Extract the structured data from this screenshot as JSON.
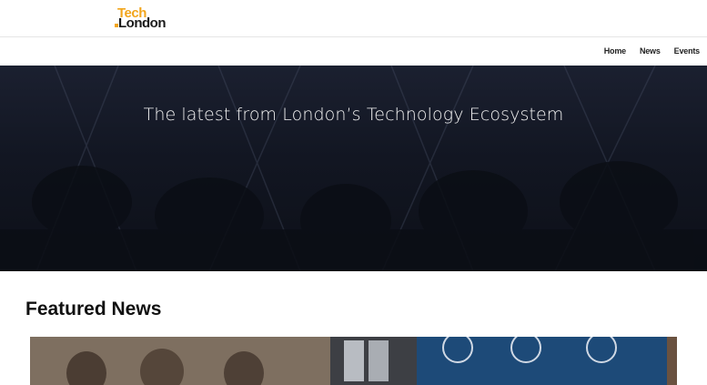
{
  "header": {
    "logo": {
      "line1": "Tech",
      "line2": "London",
      "brand_color": "#f2a51b"
    }
  },
  "nav": {
    "items": [
      {
        "label": "Home"
      },
      {
        "label": "News"
      },
      {
        "label": "Events"
      }
    ]
  },
  "hero": {
    "title": "The latest from London’s Technology Ecosystem",
    "background": "#121622"
  },
  "featured": {
    "section_title": "Featured News",
    "image_icon": "article-thumbnail-image"
  }
}
